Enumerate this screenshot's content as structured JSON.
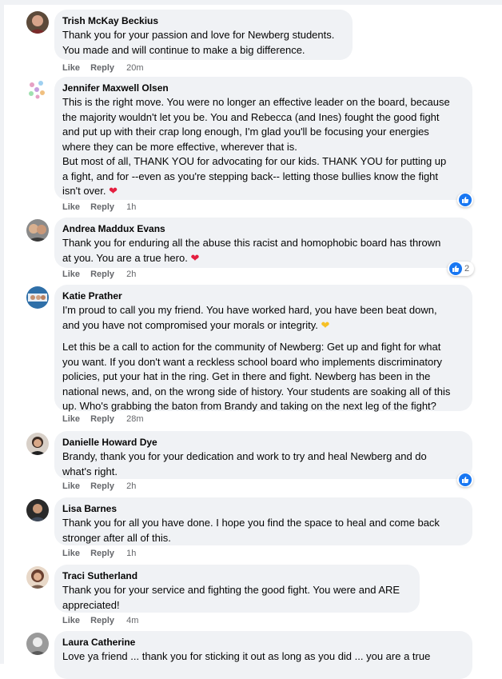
{
  "comments": [
    {
      "author": "Trish McKay Beckius",
      "text": "Thank you for your passion and love for Newberg students.\nYou made and will continue to make a big difference.",
      "time": "20m",
      "like": "Like",
      "reply": "Reply"
    },
    {
      "author": "Jennifer Maxwell Olsen",
      "text": "This is the right move. You were no longer an effective leader on the board, because\nthe majority wouldn't let you be. You and Rebecca (and Ines) fought the good fight\nand put up with their crap long enough, I'm glad you'll be focusing your energies\nwhere they can be more effective, wherever that is.\nBut most of all, THANK YOU for advocating for our kids. THANK YOU for putting up\na fight, and for --even as you're stepping back-- letting those bullies know the fight\nisn't over.",
      "time": "1h",
      "like": "Like",
      "reply": "Reply"
    },
    {
      "author": "Andrea Maddux Evans",
      "text": "Thank you for enduring all the abuse this racist and homophobic board has thrown\nat you. You are a true hero.",
      "time": "2h",
      "like": "Like",
      "reply": "Reply",
      "reaction_count": "2"
    },
    {
      "author": "Katie Prather",
      "text1": "I'm proud to call you my friend. You have worked hard, you have been beat down,\nand you have not compromised your morals or integrity.",
      "text2": "Let this be a call to action for the community of Newberg: Get up and fight for what\nyou want. If you don't want a reckless school board who implements discriminatory\npolicies, put your hat in the ring. Get in there and fight. Newberg has been in the\nnational news, and, on the wrong side of history. Your students are soaking all of this\nup. Who's grabbing the baton from Brandy and taking on the next leg of the fight?",
      "time": "28m",
      "like": "Like",
      "reply": "Reply"
    },
    {
      "author": "Danielle Howard Dye",
      "text": "Brandy, thank you for your dedication and work to try and heal Newberg and do\nwhat's right.",
      "time": "2h",
      "like": "Like",
      "reply": "Reply"
    },
    {
      "author": "Lisa Barnes",
      "text": "Thank you for all you have done. I hope you find the space to heal and come back\nstronger after all of this.",
      "time": "1h",
      "like": "Like",
      "reply": "Reply"
    },
    {
      "author": "Traci Sutherland",
      "text": "Thank you for your service and fighting the good fight. You were and ARE\nappreciated!",
      "time": "4m",
      "like": "Like",
      "reply": "Reply"
    },
    {
      "author": "Laura Catherine",
      "text": "Love ya friend ... thank you for sticking it out as long as you did ... you are a true",
      "like": "Like",
      "reply": "Reply"
    }
  ],
  "icons": {
    "like_badge": "thumbs-up-icon",
    "heart": "red-heart-emoji",
    "yellow_heart": "yellow-heart-emoji"
  },
  "colors": {
    "bubble": "#f0f2f5",
    "meta": "#65676b",
    "like_blue": "#1877f2",
    "heart_red": "#e41e3f"
  }
}
